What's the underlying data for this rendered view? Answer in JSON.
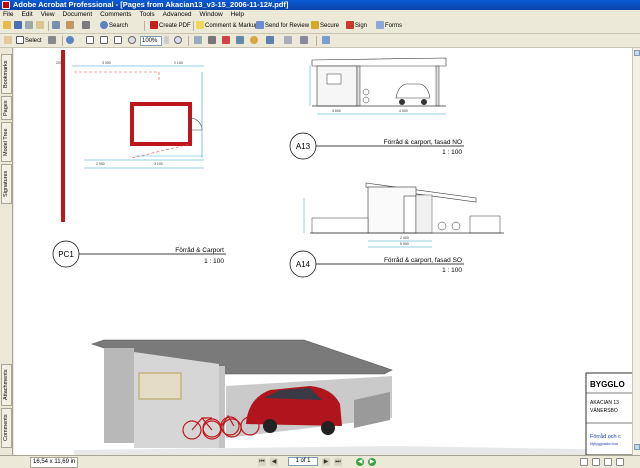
{
  "titlebar": {
    "title": "Adobe Acrobat Professional - [Pages from Akacian13_v3-15_2006-11-12#.pdf]"
  },
  "menu": [
    "File",
    "Edit",
    "View",
    "Document",
    "Comments",
    "Tools",
    "Advanced",
    "Window",
    "Help"
  ],
  "toolbar1": {
    "search": "Search",
    "create_pdf": "Create PDF",
    "comment_markup": "Comment & Markup",
    "send_review": "Send for Review",
    "secure": "Secure",
    "sign": "Sign",
    "forms": "Forms"
  },
  "toolbar2": {
    "select": "Select",
    "zoom": "100%"
  },
  "sidepanel": {
    "bookmarks": "Bookmarks",
    "pages": "Pages",
    "model_tree": "Model Tree",
    "signatures": "Signatures",
    "attachments": "Attachments",
    "comments": "Comments"
  },
  "drawing": {
    "pc1": {
      "code": "PC1",
      "title": "Förråd & Carport",
      "scale": "1 : 100"
    },
    "a13": {
      "code": "A13",
      "title": "Förråd & carport, fasad NO",
      "scale": "1 : 100"
    },
    "a14": {
      "code": "A14",
      "title": "Förråd & carport, fasad SO",
      "scale": "1 : 100"
    },
    "dims": {
      "d1": "3 300",
      "d2": "2 100",
      "d3": "2 900",
      "d4": "3 100",
      "d5": "3 500",
      "d6": "4 900",
      "d7": "2 400",
      "d8": "5 900",
      "d9": "1 400",
      "d10": "2 900",
      "d11": "200"
    },
    "titleblock": {
      "line1": "BYGGLO",
      "line2": "AKACIAN 13",
      "line3": "VÄNERSBO",
      "line4": "Förråd och c",
      "line5": "Nybyggnation bos"
    }
  },
  "status": {
    "page_size": "16,54 x 11,69 in",
    "page_num": "1 of 1"
  },
  "colors": {
    "titlebar": "#0842a8",
    "wall_red": "#c0161b",
    "dim_cyan": "#2aa0c8",
    "car_red": "#b0141c"
  }
}
